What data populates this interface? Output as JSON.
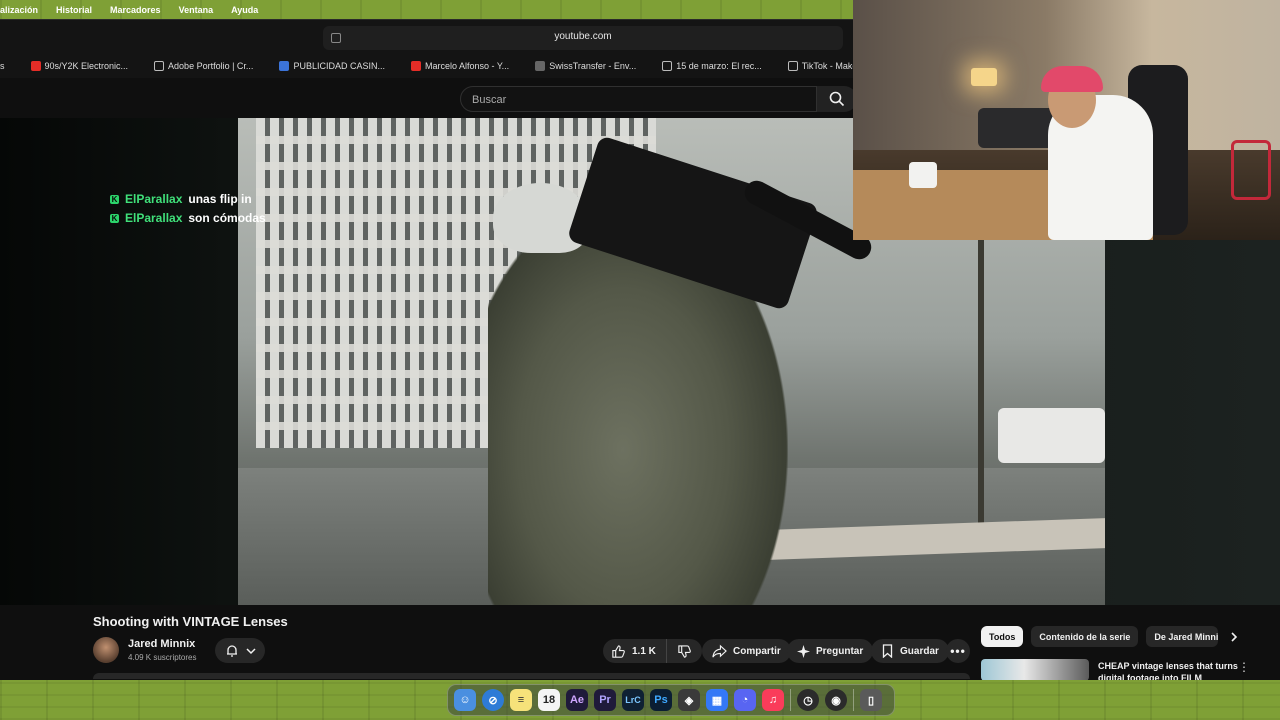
{
  "menubar": {
    "items": [
      "alización",
      "Historial",
      "Marcadores",
      "Ventana",
      "Ayuda"
    ]
  },
  "browser": {
    "url": "youtube.com",
    "bookmarks": [
      {
        "label": "s",
        "color": ""
      },
      {
        "label": "90s/Y2K Electronic...",
        "color": "#e52d27"
      },
      {
        "label": "Adobe Portfolio | Cr...",
        "color": "#444444"
      },
      {
        "label": "PUBLICIDAD CASIN...",
        "color": "#3b73d8"
      },
      {
        "label": "Marcelo Alfonso - Y...",
        "color": "#e52d27"
      },
      {
        "label": "SwissTransfer - Env...",
        "color": "#666666"
      },
      {
        "label": "15 de marzo: El rec...",
        "color": "#222222"
      },
      {
        "label": "TikTok - Make",
        "color": "#222222"
      }
    ]
  },
  "youtube": {
    "search_placeholder": "Buscar",
    "chat": [
      {
        "user": "ElParallax",
        "message": "unas flip in"
      },
      {
        "user": "ElParallax",
        "message": "son cómodas"
      }
    ],
    "video_title": "Shooting with VINTAGE Lenses",
    "channel_name": "Jared Minnix",
    "subscribers": "4.09 K suscriptores",
    "like_count": "1.1 K",
    "share_label": "Compartir",
    "ask_label": "Preguntar",
    "save_label": "Guardar",
    "chips": [
      "Todos",
      "Contenido de la serie",
      "De Jared Minnix"
    ],
    "recommended": {
      "title": "CHEAP vintage lenses that turns digital footage into FILM"
    }
  },
  "dock": {
    "items": [
      {
        "name": "finder-icon",
        "glyph": "☺"
      },
      {
        "name": "safari-icon",
        "glyph": "⊘"
      },
      {
        "name": "notes-icon",
        "glyph": "≡"
      },
      {
        "name": "calendar-icon",
        "glyph": "18"
      },
      {
        "name": "after-effects-icon",
        "glyph": "Ae"
      },
      {
        "name": "premiere-icon",
        "glyph": "Pr"
      },
      {
        "name": "lightroom-classic-icon",
        "glyph": "LrC"
      },
      {
        "name": "photoshop-icon",
        "glyph": "Ps"
      },
      {
        "name": "davinci-icon",
        "glyph": "◈"
      },
      {
        "name": "keynote-icon",
        "glyph": "▦"
      },
      {
        "name": "discord-icon",
        "glyph": "◔"
      },
      {
        "name": "music-icon",
        "glyph": "♫"
      },
      {
        "name": "activity-icon",
        "glyph": "◷"
      },
      {
        "name": "obs-icon",
        "glyph": "◉"
      },
      {
        "name": "trash-icon",
        "glyph": "▯"
      }
    ],
    "colors": {
      "desktop": "#7fa036",
      "youtube_bg": "#0f0f0f",
      "chat_user": "#40e07a"
    }
  }
}
